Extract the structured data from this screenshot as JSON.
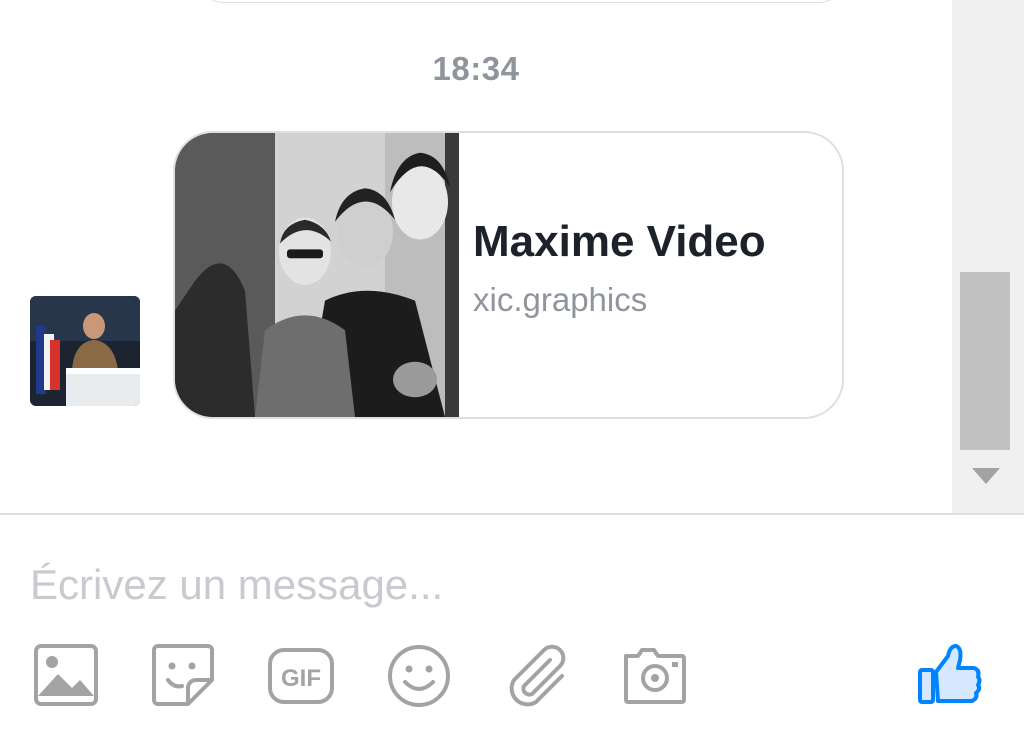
{
  "conversation": {
    "timestamp": "18:34",
    "shared_link": {
      "title": "Maxime Video",
      "domain": "xic.graphics"
    }
  },
  "composer": {
    "placeholder": "Écrivez un message...",
    "gif_label": "GIF",
    "icons": [
      "image-icon",
      "sticker-icon",
      "gif-icon",
      "emoji-icon",
      "paperclip-icon",
      "camera-icon",
      "thumbs-up-icon"
    ]
  },
  "colors": {
    "accent": "#0084ff",
    "icon_gray": "#a3a3a3",
    "timestamp": "#90949c"
  }
}
